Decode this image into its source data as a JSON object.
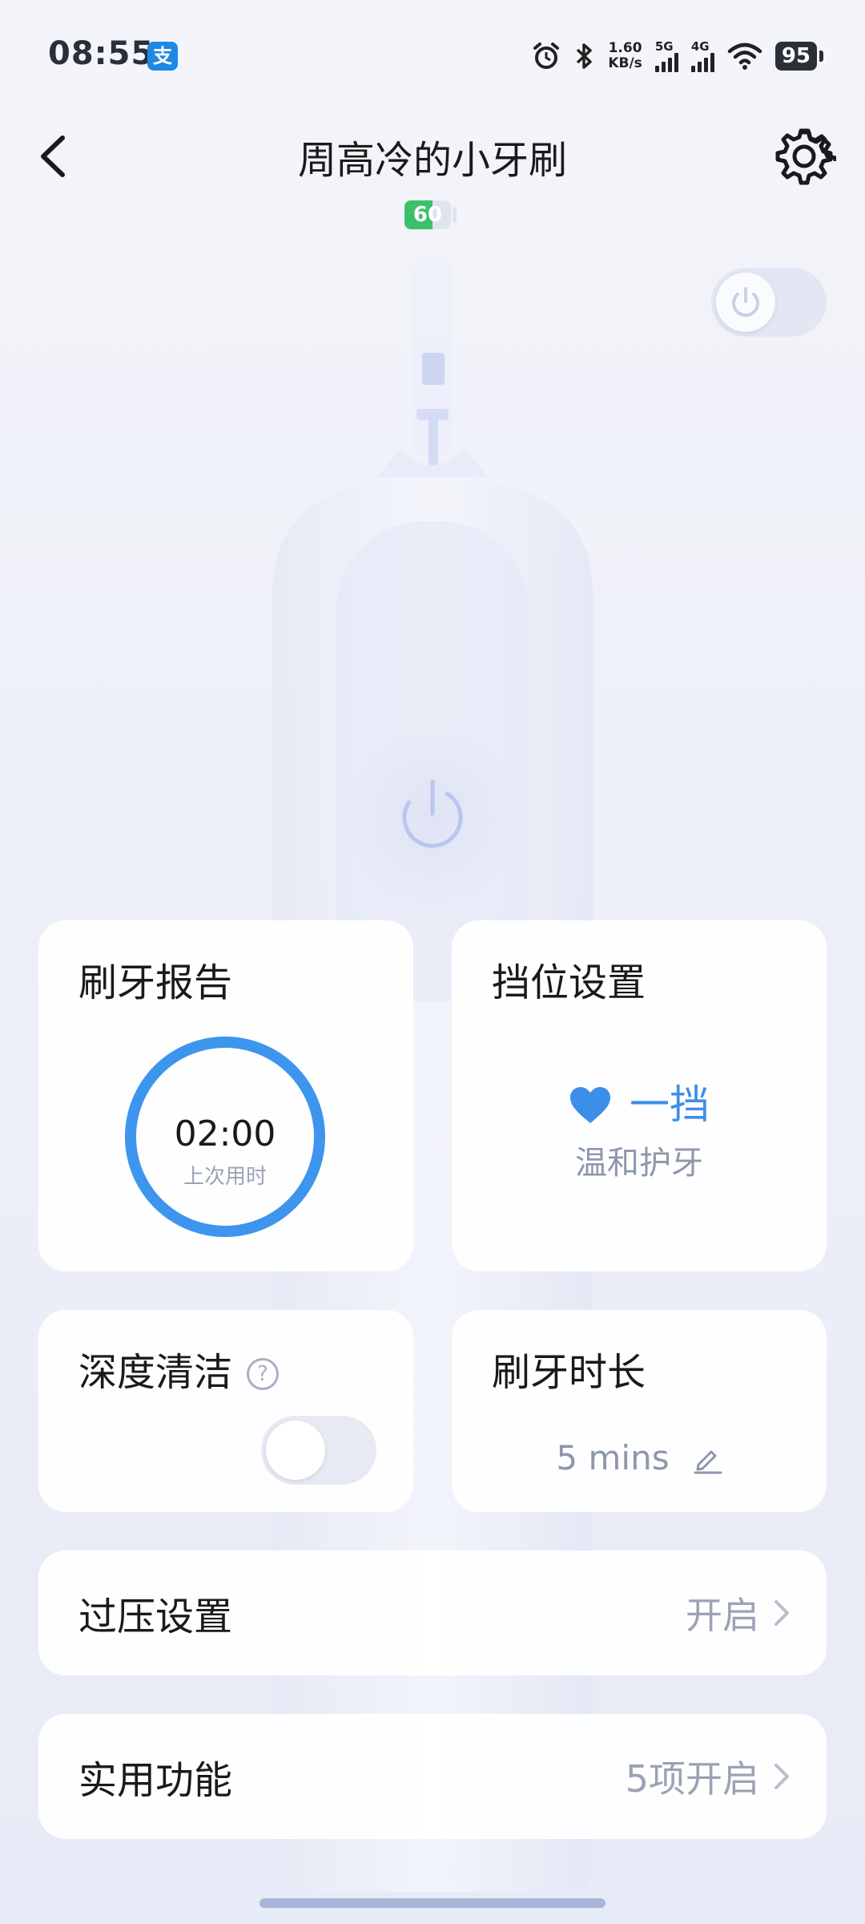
{
  "status_bar": {
    "time": "08:55",
    "alipay_glyph": "支",
    "net_speed_value": "1.60",
    "net_speed_unit": "KB/s",
    "signal1_label": "5G",
    "signal2_label": "4G",
    "battery": "95",
    "icons": [
      "alarm-icon",
      "bluetooth-icon",
      "wifi-icon"
    ]
  },
  "header": {
    "title": "周高冷的小牙刷",
    "device_battery": "60",
    "device_battery_level": 0.6
  },
  "brush_switch": {
    "on": false
  },
  "cards": {
    "report": {
      "title": "刷牙报告",
      "time": "02:00",
      "subtitle": "上次用时"
    },
    "gear": {
      "title": "挡位设置",
      "level": "一挡",
      "description": "温和护牙"
    },
    "deep_clean": {
      "title": "深度清洁",
      "help_glyph": "?",
      "enabled": false
    },
    "duration": {
      "title": "刷牙时长",
      "value": "5 mins"
    },
    "pressure": {
      "title": "过压设置",
      "value": "开启"
    },
    "functions": {
      "title": "实用功能",
      "value": "5项开启"
    }
  },
  "colors": {
    "accent": "#3d95ee",
    "battery_green": "#3cc16a",
    "muted": "#9aa3b5"
  }
}
